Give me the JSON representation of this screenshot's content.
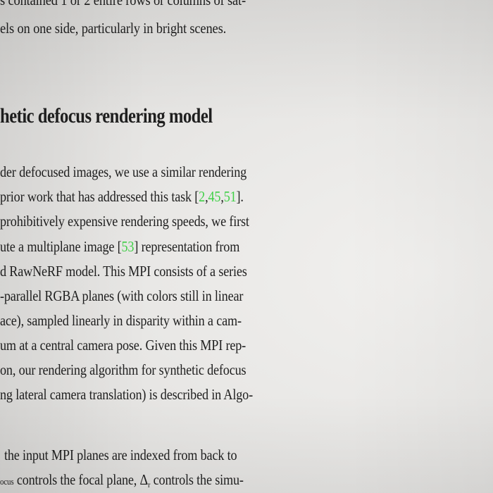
{
  "paper": {
    "line_top_partial": "s contained 1 or 2 entire rows or columns of sat-",
    "line_top": "els on one side, particularly in bright scenes.",
    "heading": "hetic defocus rendering model",
    "p1": [
      "der defocused images, we use a similar rendering",
      {
        "before": "prior work that has addressed this task [",
        "c1": "2",
        "s1": ",",
        "c2": "45",
        "s2": ",",
        "c3": "51",
        "after": "]."
      },
      "prohibitively expensive rendering speeds, we first",
      {
        "before": "ute a multiplane image [",
        "c1": "53",
        "after": "] representation from"
      },
      "d RawNeRF model. This MPI consists of a series",
      "-parallel RGBA planes (with colors still in linear",
      "ace), sampled linearly in disparity within a cam-",
      "um at a central camera pose. Given this MPI rep-",
      "on, our rendering algorithm for synthetic defocus",
      "ng lateral camera translation) is described in Algo-"
    ],
    "p2": [
      "the input MPI planes are indexed from back to",
      {
        "pre": "ocus",
        "mid": " controls the focal plane, Δ",
        "sub": "r",
        "post": " controls the simu-"
      }
    ],
    "colors": {
      "text": "#1f1f1f",
      "citation": "#3fd046",
      "background": "#e7e6e4"
    }
  }
}
